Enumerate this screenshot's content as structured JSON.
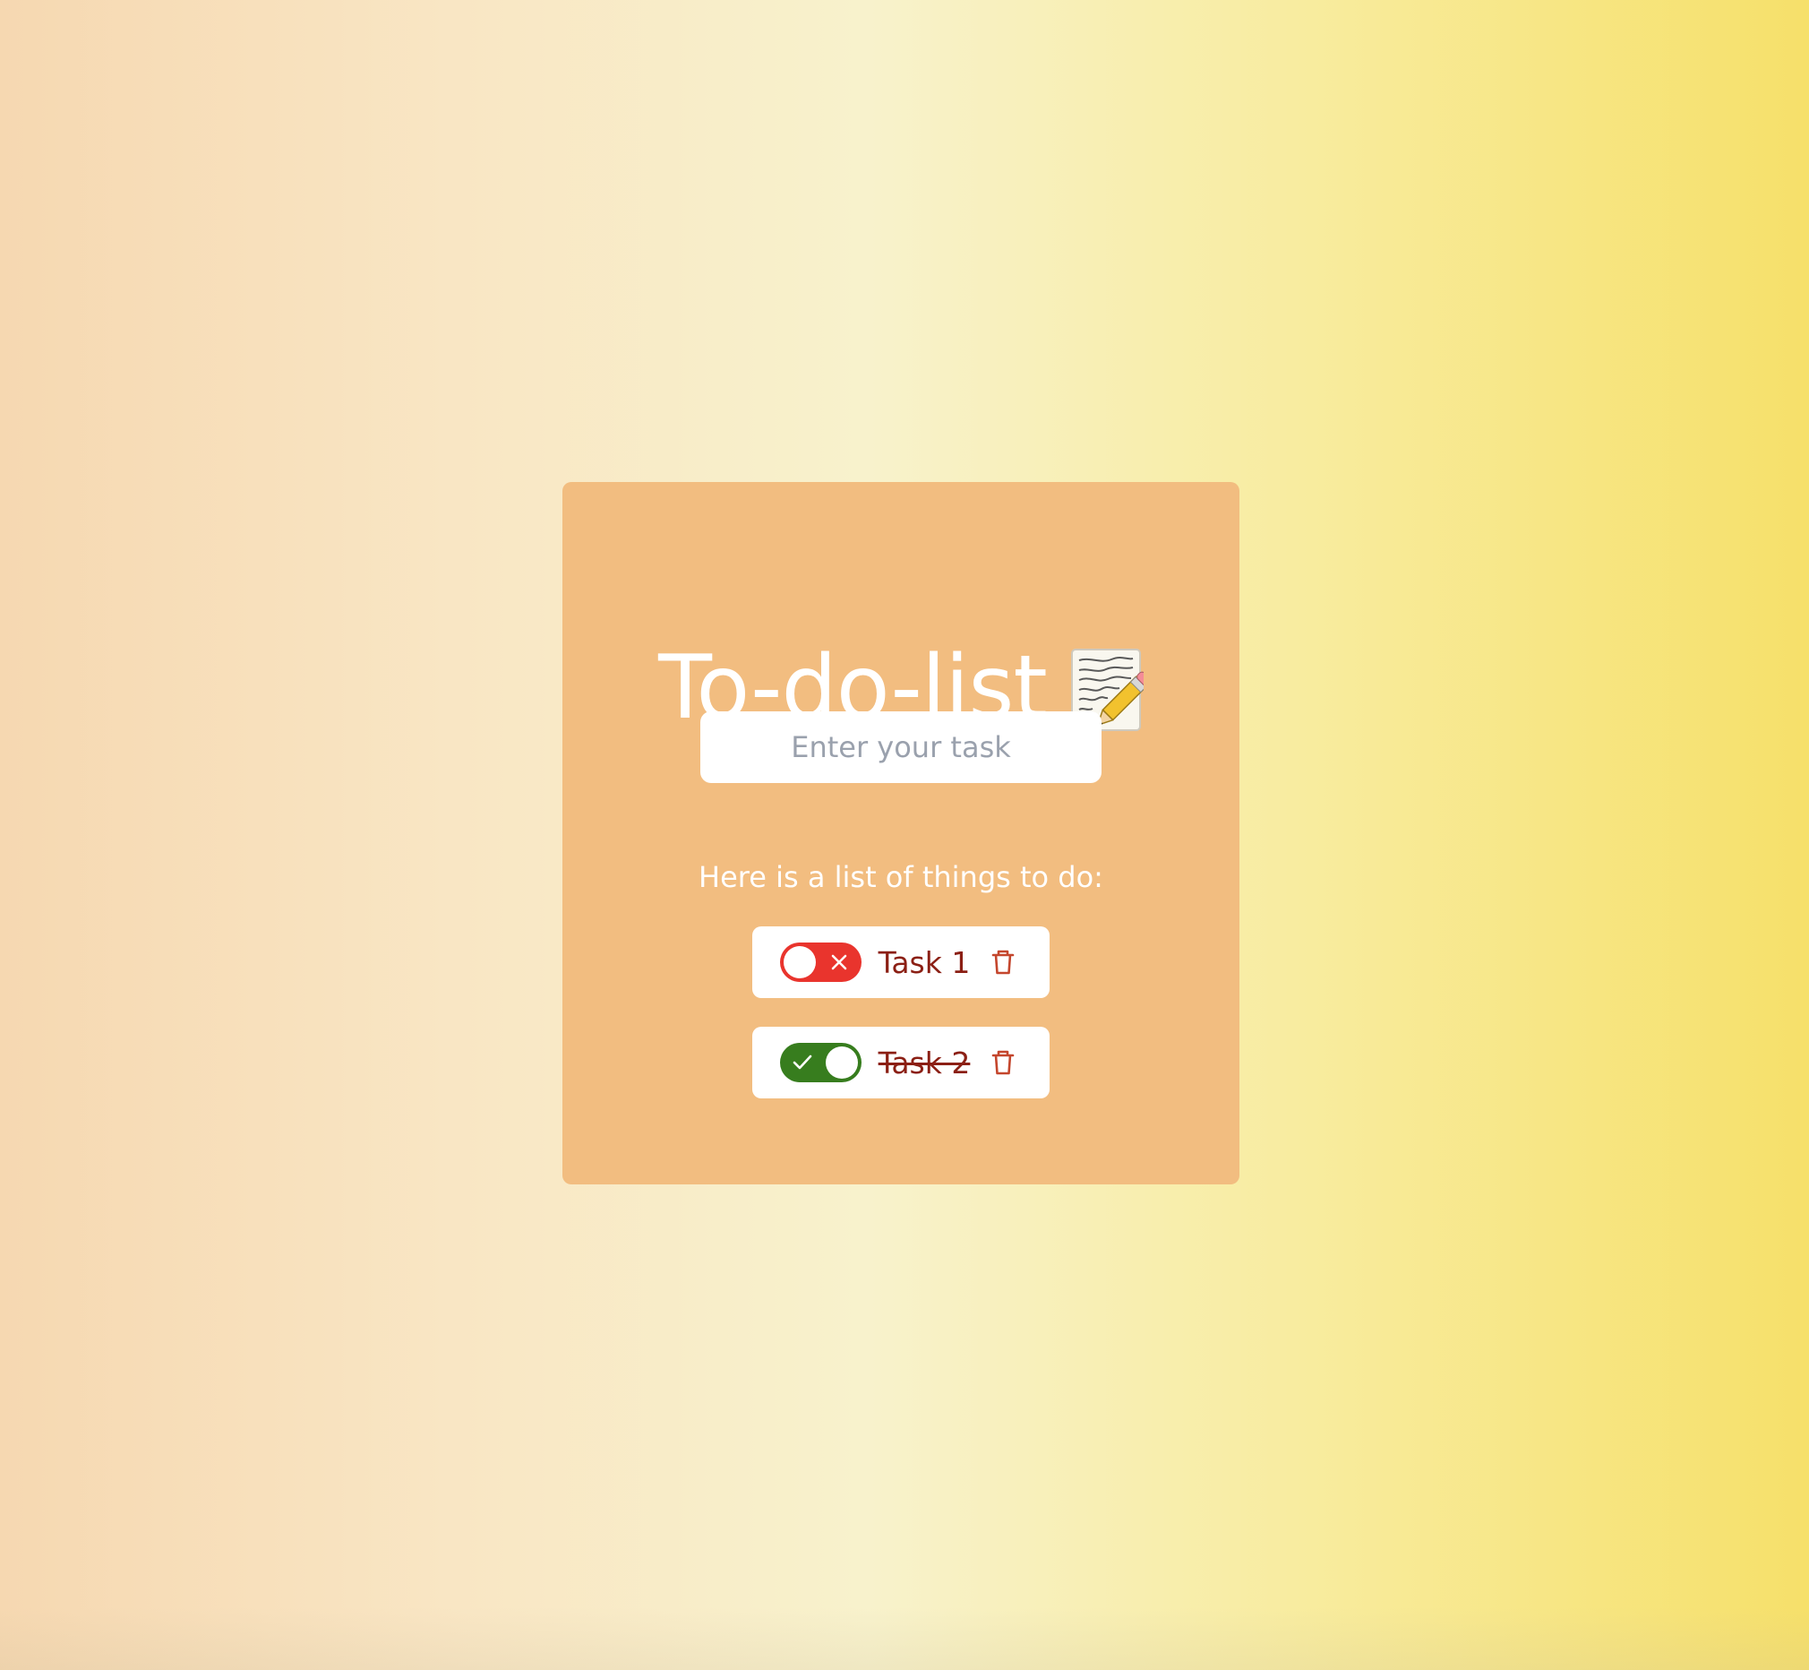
{
  "header": {
    "title": "To-do-list",
    "title_icon": "notepad-pencil-icon"
  },
  "input": {
    "placeholder": "Enter your task",
    "value": ""
  },
  "list": {
    "heading": "Here is a list of things to do:",
    "tasks": [
      {
        "label": "Task 1",
        "completed": false,
        "toggle_state_icon": "close-icon",
        "delete_icon": "trash-icon"
      },
      {
        "label": "Task 2",
        "completed": true,
        "toggle_state_icon": "check-icon",
        "delete_icon": "trash-icon"
      }
    ]
  },
  "colors": {
    "card_background": "#f2bd80",
    "title_text": "#ffffff",
    "task_text": "#8b1f14",
    "toggle_off": "#e9342d",
    "toggle_on": "#377d1e",
    "delete_icon": "#c4462d"
  }
}
